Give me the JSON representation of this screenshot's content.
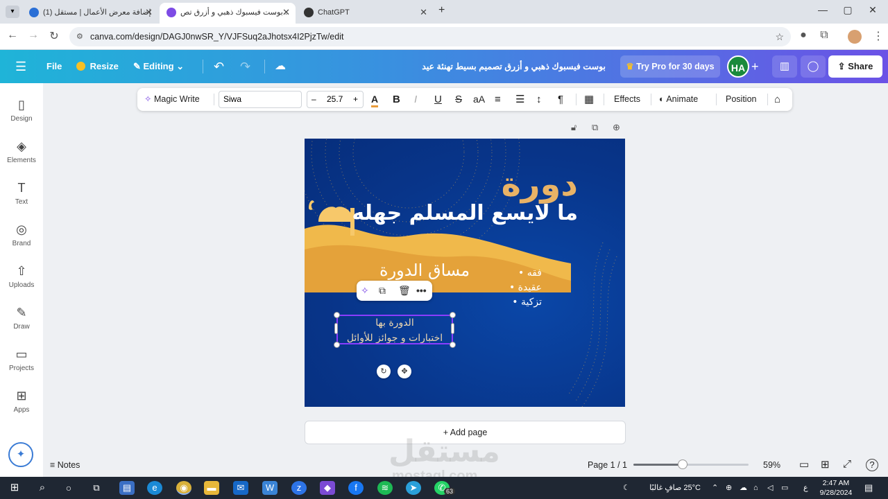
{
  "browser": {
    "tabs": [
      {
        "title": "(1) إضافة معرض الأعمال | مستقل",
        "active": false
      },
      {
        "title": "بوست فيسبوك ذهبي و أزرق تص...",
        "active": true
      },
      {
        "title": "ChatGPT",
        "active": false
      }
    ],
    "new_tab": "+",
    "url": "canva.com/design/DAGJ0nwSR_Y/VJFSuq2aJhotsx4I2PjzTw/edit"
  },
  "header": {
    "menu_icon": "☰",
    "file": "File",
    "resize": "Resize",
    "editing": "Editing",
    "doc_title": "بوست فيسبوك ذهبي و أزرق تصميم بسيط تهنئة عيد الأضحى",
    "try_pro": "Try Pro for 30 days",
    "avatar": "HA",
    "share": "Share"
  },
  "sidebar": {
    "items": [
      {
        "label": "Design",
        "icon": "▯"
      },
      {
        "label": "Elements",
        "icon": "◈"
      },
      {
        "label": "Text",
        "icon": "T"
      },
      {
        "label": "Brand",
        "icon": "◎"
      },
      {
        "label": "Uploads",
        "icon": "⇧"
      },
      {
        "label": "Draw",
        "icon": "✎"
      },
      {
        "label": "Projects",
        "icon": "▭"
      },
      {
        "label": "Apps",
        "icon": "⊞"
      }
    ]
  },
  "toolbar": {
    "magic_write": "Magic Write",
    "font": "Siwa",
    "font_size": "25.7",
    "minus": "–",
    "plus": "+",
    "bold": "B",
    "italic": "I",
    "underline": "U",
    "strike": "S",
    "case": "aA",
    "effects": "Effects",
    "animate": "Animate",
    "position": "Position"
  },
  "design": {
    "title_line1": "دورة",
    "title_line2": "ما لايسع المسلم جهله",
    "subtitle": "مساق الدورة",
    "bullets": [
      "فقه",
      "عقيدة",
      "تزكية"
    ],
    "selected_text_line1": "الدورة بها",
    "selected_text_line2": "اختبارات و جوائز للأوائل",
    "colors": {
      "background": "#08358a",
      "gold": "#e9b366",
      "accent_select": "#8b3dff"
    }
  },
  "canvas": {
    "add_page": "+ Add page"
  },
  "footer": {
    "notes": "Notes",
    "page": "Page 1 / 1",
    "zoom": "59%",
    "zoom_value": 0.43
  },
  "taskbar": {
    "weather": "25°C  صافٍ غالبًا",
    "lang": "ع",
    "time": "2:47 AM",
    "date": "9/28/2024",
    "badge": "63"
  },
  "watermark": {
    "ar": "مستقل",
    "en": "mostaql.com"
  }
}
